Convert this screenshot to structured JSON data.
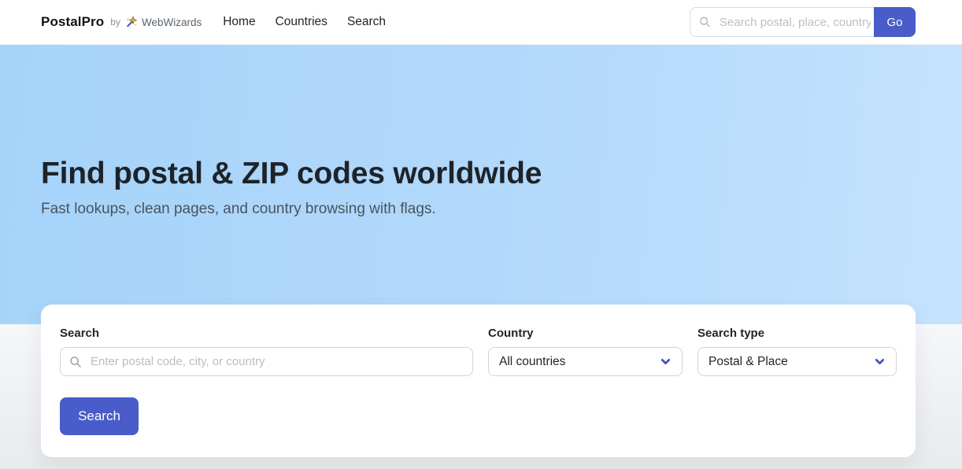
{
  "brand": {
    "name": "PostalPro",
    "byline_prefix": "by",
    "byline_name": "WebWizards",
    "icon": "magic-wand-icon"
  },
  "nav": {
    "items": [
      {
        "label": "Home"
      },
      {
        "label": "Countries"
      },
      {
        "label": "Search"
      }
    ]
  },
  "nav_search": {
    "icon": "search-icon",
    "placeholder": "Search postal, place, country",
    "value": "",
    "go_label": "Go"
  },
  "hero": {
    "title": "Find postal & ZIP codes worldwide",
    "subtitle": "Fast lookups, clean pages, and country browsing with flags."
  },
  "search_card": {
    "search": {
      "label": "Search",
      "icon": "search-icon",
      "placeholder": "Enter postal code, city, or country",
      "value": ""
    },
    "country": {
      "label": "Country",
      "selected_option": "All countries",
      "icon": "chevron-down-icon"
    },
    "search_type": {
      "label": "Search type",
      "selected_option": "Postal & Place",
      "icon": "chevron-down-icon"
    },
    "submit_label": "Search"
  },
  "colors": {
    "accent": "#4a5cc9",
    "chevron": "#3f51c5",
    "hero_gradient_start": "#a5d3fa",
    "hero_gradient_end": "#c6e2fd",
    "lower_bg_start": "#f6f7f9",
    "lower_bg_end": "#e8eaec"
  }
}
